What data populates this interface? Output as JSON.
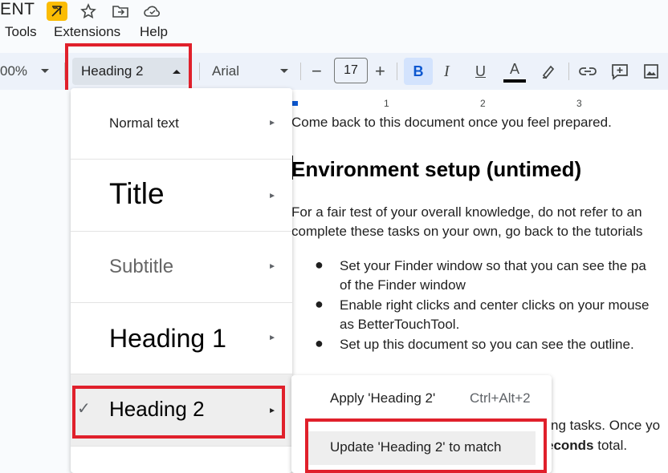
{
  "app": {
    "doc_title_fragment": "ENT"
  },
  "menubar": {
    "items": [
      "Tools",
      "Extensions",
      "Help"
    ]
  },
  "toolbar": {
    "zoom": "00%",
    "style_value": "Heading 2",
    "font_value": "Arial",
    "font_size": "17",
    "minus": "−",
    "plus": "+",
    "bold": "B",
    "italic": "I",
    "underline": "U",
    "text_color_letter": "A"
  },
  "ruler": {
    "ticks": [
      "1",
      "2",
      "3"
    ]
  },
  "document": {
    "line1": "Come back to this document once you feel prepared.",
    "heading": "Environment setup (untimed)",
    "para_line1": "For a fair test of your overall knowledge, do not refer to an",
    "para_line2": "complete these tasks on your own, go back to the tutorials",
    "bullets": [
      {
        "line1": "Set your Finder window so that you can see the pa",
        "line2": "of the Finder window"
      },
      {
        "line1": "Enable right clicks and center clicks on your mouse",
        "line2": "as BetterTouchTool."
      },
      {
        "line1": "Set up this document so you can see the outline.",
        "line2": ""
      }
    ],
    "frag1": "ng tasks. Once yo",
    "frag2_bold": "econds",
    "frag2_rest": " total."
  },
  "style_menu": {
    "items": [
      {
        "label": "Normal text",
        "checked": false
      },
      {
        "label": "Title",
        "checked": false
      },
      {
        "label": "Subtitle",
        "checked": false
      },
      {
        "label": "Heading 1",
        "checked": false
      },
      {
        "label": "Heading 2",
        "checked": true
      }
    ],
    "checkmark": "✓",
    "arrow": "►"
  },
  "submenu": {
    "apply_label": "Apply 'Heading 2'",
    "apply_shortcut": "Ctrl+Alt+2",
    "update_label": "Update 'Heading 2' to match"
  },
  "colors": {
    "highlight_red": "#e0202b",
    "accent_blue": "#0b57d0",
    "toolbar_bg": "#edf2fa"
  }
}
